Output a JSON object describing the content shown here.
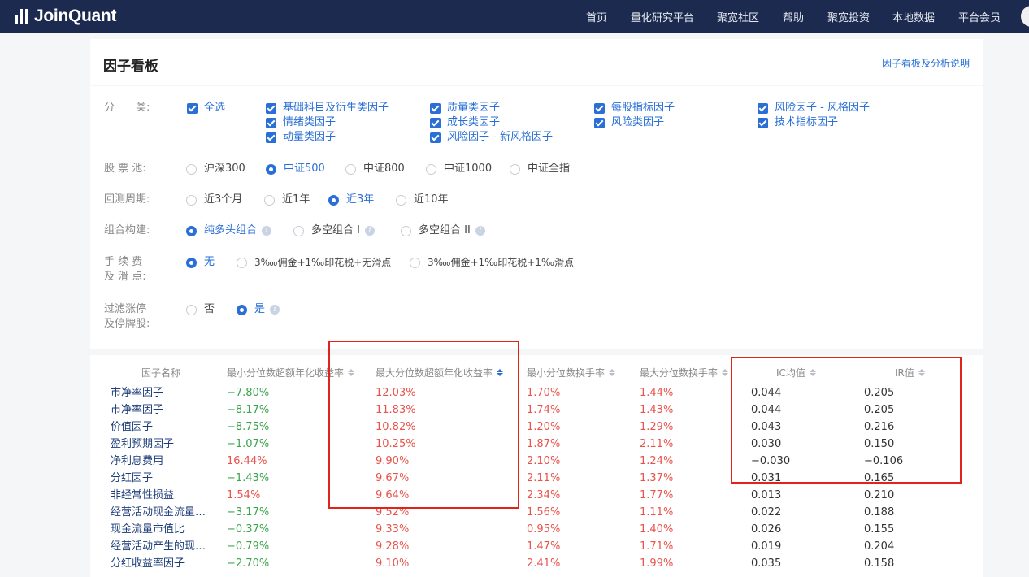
{
  "nav": {
    "logo_text": "JoinQuant",
    "links": [
      "首页",
      "量化研究平台",
      "聚宽社区",
      "帮助",
      "聚宽投资",
      "本地数据",
      "平台会员"
    ]
  },
  "header": {
    "title": "因子看板",
    "help_link": "因子看板及分析说明"
  },
  "filters": {
    "category": {
      "label": "分　　类:",
      "all": "全选",
      "items": [
        "基础科目及衍生类因子",
        "质量类因子",
        "每股指标因子",
        "风险因子 - 风格因子",
        "情绪类因子",
        "成长类因子",
        "风险类因子",
        "技术指标因子",
        "动量类因子",
        "风险因子 - 新风格因子"
      ]
    },
    "pool": {
      "label": "股 票 池:",
      "options": [
        "沪深300",
        "中证500",
        "中证800",
        "中证1000",
        "中证全指"
      ],
      "selected": "中证500"
    },
    "period": {
      "label": "回测周期:",
      "options": [
        "近3个月",
        "近1年",
        "近3年",
        "近10年"
      ],
      "selected": "近3年"
    },
    "portfolio": {
      "label": "组合构建:",
      "options": [
        "纯多头组合",
        "多空组合 I",
        "多空组合 II"
      ],
      "selected": "纯多头组合"
    },
    "fee": {
      "label_line1": "手 续 费",
      "label_line2": "及 滑 点:",
      "options": [
        "无",
        "3‱佣金+1‰印花税+无滑点",
        "3‱佣金+1‰印花税+1‰滑点"
      ],
      "selected": "无"
    },
    "limit": {
      "label_line1": "过滤涨停",
      "label_line2": "及停牌股:",
      "options": [
        "否",
        "是"
      ],
      "selected": "是"
    }
  },
  "table": {
    "headers": [
      "因子名称",
      "最小分位数超额年化收益率",
      "最大分位数超额年化收益率",
      "最小分位数换手率",
      "最大分位数换手率",
      "IC均值",
      "IR值"
    ],
    "rows": [
      [
        "市净率因子",
        "−7.80%",
        "12.03%",
        "1.70%",
        "1.44%",
        "0.044",
        "0.205"
      ],
      [
        "市净率因子",
        "−8.17%",
        "11.83%",
        "1.74%",
        "1.43%",
        "0.044",
        "0.205"
      ],
      [
        "价值因子",
        "−8.75%",
        "10.82%",
        "1.20%",
        "1.29%",
        "0.043",
        "0.216"
      ],
      [
        "盈利预期因子",
        "−1.07%",
        "10.25%",
        "1.87%",
        "2.11%",
        "0.030",
        "0.150"
      ],
      [
        "净利息费用",
        "16.44%",
        "9.90%",
        "2.10%",
        "1.24%",
        "−0.030",
        "−0.106"
      ],
      [
        "分红因子",
        "−1.43%",
        "9.67%",
        "2.11%",
        "1.37%",
        "0.031",
        "0.165"
      ],
      [
        "非经常性损益",
        "1.54%",
        "9.64%",
        "2.34%",
        "1.77%",
        "0.013",
        "0.210"
      ],
      [
        "经营活动现金流量…",
        "−3.17%",
        "9.52%",
        "1.56%",
        "1.11%",
        "0.022",
        "0.188"
      ],
      [
        "现金流量市值比",
        "−0.37%",
        "9.33%",
        "0.95%",
        "1.40%",
        "0.026",
        "0.155"
      ],
      [
        "经营活动产生的现…",
        "−0.79%",
        "9.28%",
        "1.47%",
        "1.71%",
        "0.019",
        "0.204"
      ],
      [
        "分红收益率因子",
        "−2.70%",
        "9.10%",
        "2.41%",
        "1.99%",
        "0.035",
        "0.158"
      ]
    ],
    "min_colors": [
      "green",
      "green",
      "green",
      "green",
      "red",
      "green",
      "red",
      "green",
      "green",
      "green",
      "green"
    ]
  },
  "colors": {
    "nav_bg": "#1b2a4e",
    "accent_blue": "#2a6fd6",
    "positive_red": "#e9534b",
    "negative_green": "#3aa54b",
    "annotation_red": "#e0231b"
  }
}
